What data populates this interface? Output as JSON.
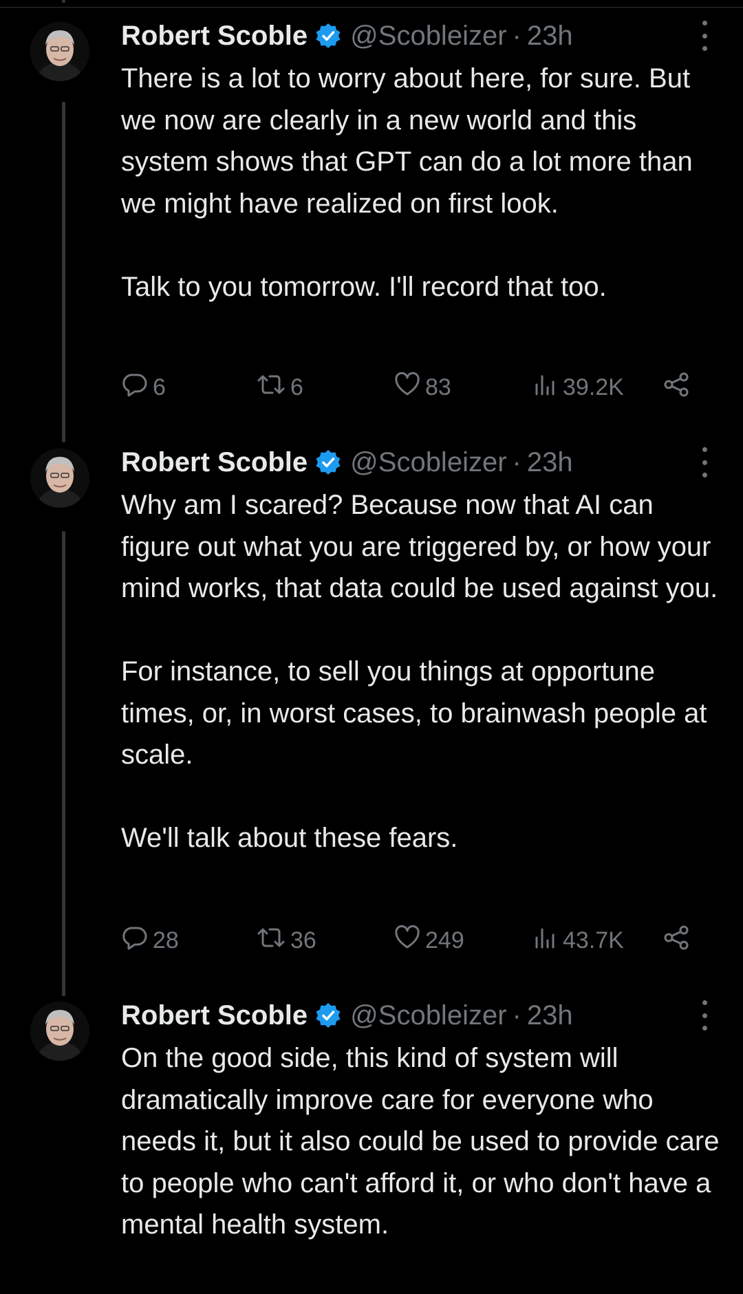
{
  "tweets": [
    {
      "author": {
        "name": "Robert Scoble",
        "handle": "@Scobleizer",
        "separator": "·",
        "time": "23h"
      },
      "paragraphs": [
        "There is a lot to worry about here, for sure. But we now are clearly in a new world and this system shows that GPT can do a lot more than we might have realized on first look.",
        "Talk to you tomorrow. I'll record that too."
      ],
      "stats": {
        "replies": "6",
        "retweets": "6",
        "likes": "83",
        "views": "39.2K"
      }
    },
    {
      "author": {
        "name": "Robert Scoble",
        "handle": "@Scobleizer",
        "separator": "·",
        "time": "23h"
      },
      "paragraphs": [
        "Why am I scared? Because now that AI can figure out what you are triggered by, or how your mind works, that data could be used against you.",
        "For instance, to sell you things at opportune times, or, in worst cases, to brainwash people at scale.",
        "We'll talk about these fears."
      ],
      "stats": {
        "replies": "28",
        "retweets": "36",
        "likes": "249",
        "views": "43.7K"
      }
    },
    {
      "author": {
        "name": "Robert Scoble",
        "handle": "@Scobleizer",
        "separator": "·",
        "time": "23h"
      },
      "paragraphs": [
        "On the good side, this kind of system will dramatically improve care for everyone who needs it, but it also could be used to provide care to people who can't afford it, or who don't have a mental health system."
      ]
    }
  ],
  "icons": {
    "verified": "verified-badge-icon",
    "more": "more-options-icon",
    "reply": "reply-icon",
    "retweet": "retweet-icon",
    "like": "like-icon",
    "views": "views-icon",
    "share": "share-icon"
  },
  "colors": {
    "background": "#000000",
    "text_primary": "#e7e9ea",
    "text_secondary": "#71767b",
    "verified_blue": "#1d9bf0",
    "thread_line": "#333639"
  }
}
